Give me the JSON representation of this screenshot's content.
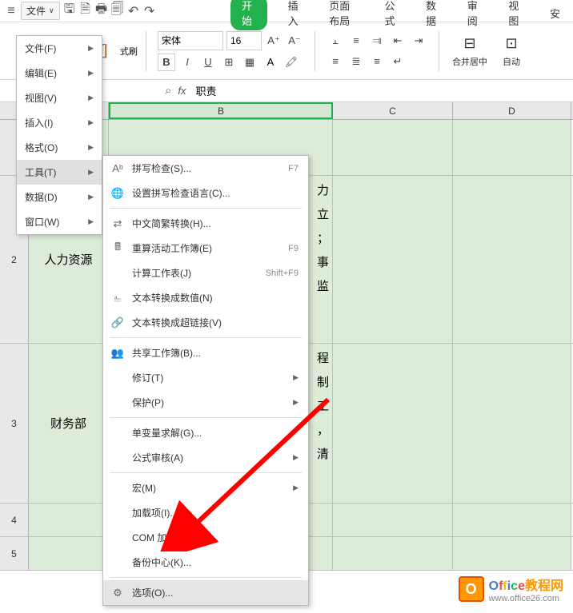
{
  "titlebar": {
    "file_label": "文件",
    "menu_icon": "≡"
  },
  "ribbon_tabs": {
    "start": "开始",
    "insert": "插入",
    "page_layout": "页面布局",
    "formula": "公式",
    "data": "数据",
    "review": "审阅",
    "view": "视图",
    "more": "安"
  },
  "ribbon": {
    "format_painter": "式刷",
    "font_name": "宋体",
    "font_size": "16",
    "merge_center": "合并居中",
    "auto": "自动"
  },
  "formula_bar": {
    "find_icon": "⌕",
    "fx": "fx",
    "value": "职责"
  },
  "sheet": {
    "cols": {
      "b": "B",
      "c": "C",
      "d": "D"
    },
    "rows": {
      "r2": {
        "num": "2",
        "a": "人力资源",
        "b_lines": [
          "力",
          "立",
          "；",
          "事",
          "监"
        ]
      },
      "r3": {
        "num": "3",
        "a": "财务部",
        "b_lines": [
          "程",
          "制",
          "工",
          "，",
          "清"
        ]
      },
      "r4": {
        "num": "4"
      },
      "r5": {
        "num": "5"
      }
    }
  },
  "file_menu": {
    "items": [
      {
        "label": "文件(F)"
      },
      {
        "label": "编辑(E)"
      },
      {
        "label": "视图(V)"
      },
      {
        "label": "插入(I)"
      },
      {
        "label": "格式(O)"
      },
      {
        "label": "工具(T)",
        "hl": true
      },
      {
        "label": "数据(D)"
      },
      {
        "label": "窗口(W)"
      }
    ]
  },
  "tools_menu": {
    "items": [
      {
        "icon": "Aᵇ",
        "label": "拼写检查(S)...",
        "shortcut": "F7"
      },
      {
        "icon": "🌐",
        "label": "设置拼写检查语言(C)..."
      },
      {
        "sep": true
      },
      {
        "icon": "⇄",
        "label": "中文简繁转换(H)..."
      },
      {
        "icon": "🖩",
        "label": "重算活动工作簿(E)",
        "shortcut": "F9"
      },
      {
        "label": "计算工作表(J)",
        "shortcut": "Shift+F9"
      },
      {
        "icon": "⎁",
        "label": "文本转换成数值(N)"
      },
      {
        "icon": "🔗",
        "label": "文本转换成超链接(V)"
      },
      {
        "sep": true
      },
      {
        "icon": "👥",
        "label": "共享工作簿(B)..."
      },
      {
        "label": "修订(T)",
        "arrow": true
      },
      {
        "label": "保护(P)",
        "arrow": true
      },
      {
        "sep": true
      },
      {
        "label": "单变量求解(G)..."
      },
      {
        "label": "公式审核(A)",
        "arrow": true
      },
      {
        "sep": true
      },
      {
        "label": "宏(M)",
        "arrow": true
      },
      {
        "label": "加载项(I)..."
      },
      {
        "label": "COM 加载项(U)..."
      },
      {
        "label": "备份中心(K)..."
      },
      {
        "sep": true
      },
      {
        "icon": "⚙",
        "label": "选项(O)...",
        "hl": true
      }
    ]
  },
  "watermark": {
    "cn": "教程网",
    "url": "www.office26.com"
  }
}
